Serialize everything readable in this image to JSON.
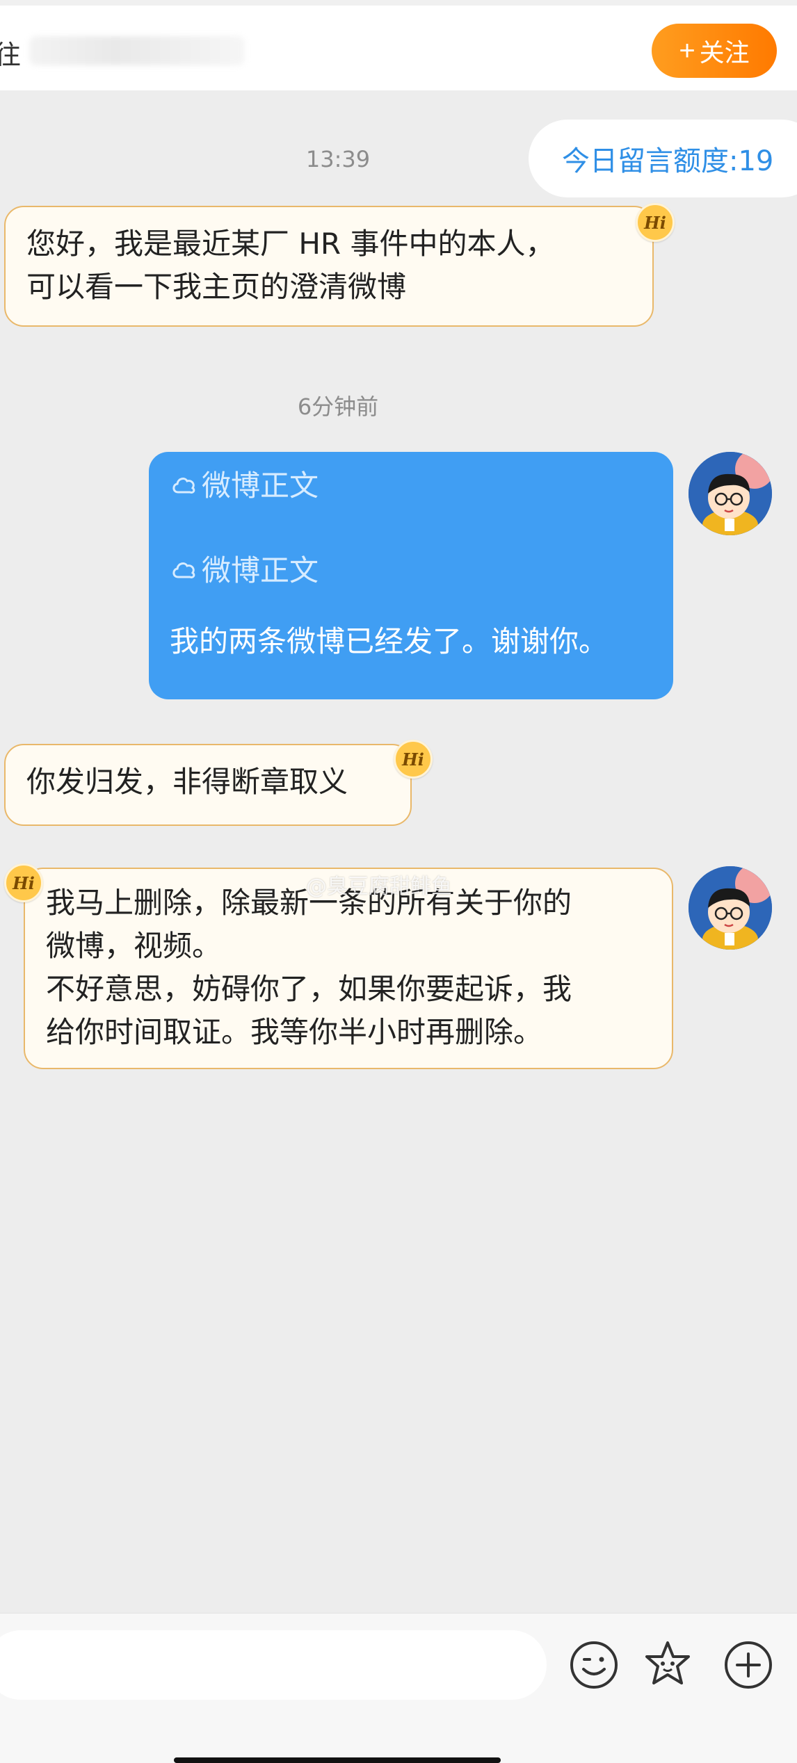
{
  "header": {
    "edge_char": "往",
    "follow_label": "关注"
  },
  "quota": {
    "label": "今日留言额度:19"
  },
  "timestamps": [
    "13:39",
    "6分钟前"
  ],
  "messages": {
    "m1": {
      "lines": [
        "您好，我是最近某厂 HR 事件中的本人，",
        "可以看一下我主页的澄清微博"
      ]
    },
    "m2": {
      "link1": "微博正文",
      "link2": "微博正文",
      "text": "我的两条微博已经发了。谢谢你。"
    },
    "m3": {
      "lines": [
        "你发归发，非得断章取义"
      ]
    },
    "m4": {
      "lines": [
        "我马上删除，除最新一条的所有关于你的",
        "微博，视频。",
        "不好意思，妨碍你了，如果你要起诉，我",
        "给你时间取证。我等你半小时再删除。"
      ]
    }
  },
  "hi_badge": "Hi",
  "watermark": "@臭豆腐甜鲱鱼",
  "toolbar": {
    "icons": [
      "emoji-icon",
      "sticker-icon",
      "plus-icon"
    ]
  },
  "colors": {
    "accent_orange": "#ff8a0f",
    "bubble_blue": "#409ef3",
    "bubble_in_bg": "#fffbf2",
    "quota_blue": "#2f8fe6"
  }
}
